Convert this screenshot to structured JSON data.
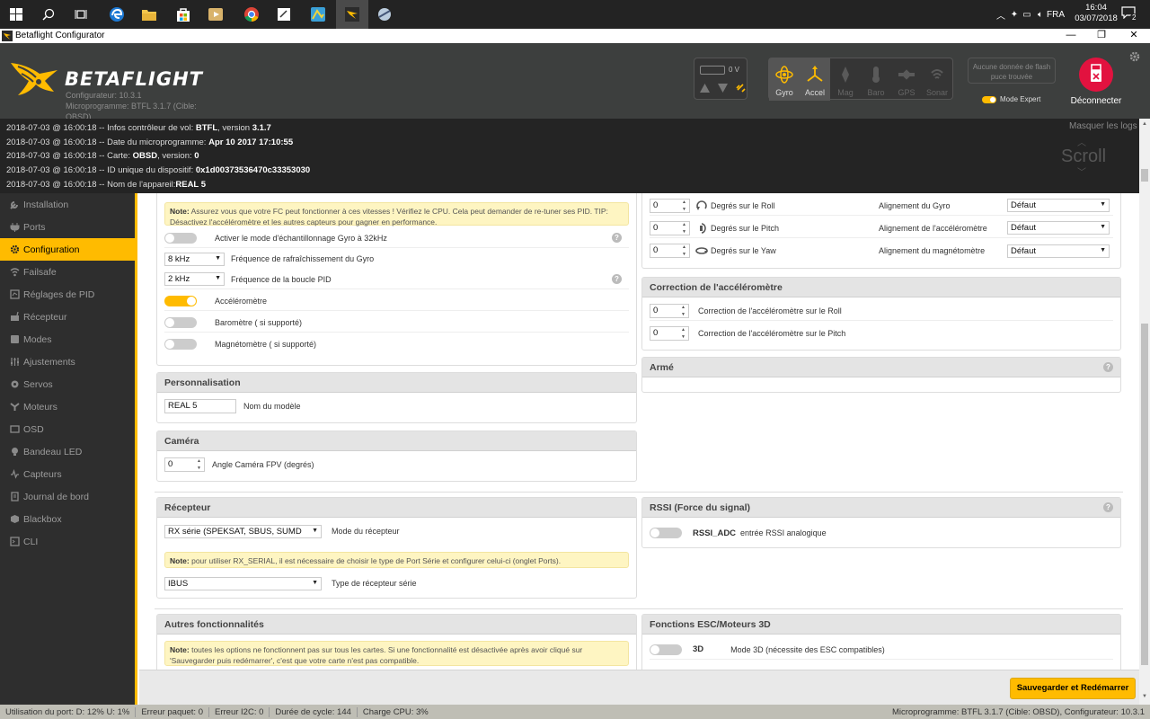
{
  "taskbar": {
    "language": "FRA",
    "time": "16:04",
    "date": "03/07/2018",
    "notification_count": "2"
  },
  "window": {
    "title": "Betaflight Configurator",
    "minimize": "—",
    "maximize": "❐",
    "close": "✕"
  },
  "header": {
    "logo_text": "BETAFLIGHT",
    "configurator_version": "Configurateur: 10.3.1",
    "firmware_line1": "Microprogramme: BTFL 3.1.7 (Cible:",
    "firmware_line2": "OBSD)",
    "battery_voltage": "0 V",
    "sensors": [
      {
        "label": "Gyro",
        "icon": "gyro-icon",
        "active": true
      },
      {
        "label": "Accel",
        "icon": "accel-icon",
        "active": true
      },
      {
        "label": "Mag",
        "icon": "mag-icon",
        "active": false
      },
      {
        "label": "Baro",
        "icon": "baro-icon",
        "active": false
      },
      {
        "label": "GPS",
        "icon": "gps-icon",
        "active": false
      },
      {
        "label": "Sonar",
        "icon": "sonar-icon",
        "active": false
      }
    ],
    "no_data": "Aucune donnée de flash puce trouvée",
    "expert_mode": "Mode Expert",
    "disconnect": "Déconnecter"
  },
  "log": {
    "hide": "Masquer les logs",
    "scroll": "Scroll",
    "lines": [
      {
        "prefix": "2018-07-03 @ 16:00:18 -- Infos contrôleur de vol: ",
        "b1": "BTFL",
        "mid": ", version ",
        "b2": "3.1.7"
      },
      {
        "prefix": "2018-07-03 @ 16:00:18 -- Date du microprogramme: ",
        "b1": "Apr 10 2017 17:10:55",
        "mid": "",
        "b2": ""
      },
      {
        "prefix": "2018-07-03 @ 16:00:18 -- Carte: ",
        "b1": "OBSD",
        "mid": ", version: ",
        "b2": "0"
      },
      {
        "prefix": "2018-07-03 @ 16:00:18 -- ID unique du dispositif: ",
        "b1": "0x1d00373536470c33353030",
        "mid": "",
        "b2": ""
      },
      {
        "prefix": "2018-07-03 @ 16:00:18 -- Nom de l'appareil:",
        "b1": "REAL 5",
        "mid": "",
        "b2": ""
      }
    ]
  },
  "sidebar": {
    "items": [
      {
        "label": "Installation",
        "icon": "wrench-icon"
      },
      {
        "label": "Ports",
        "icon": "plug-icon"
      },
      {
        "label": "Configuration",
        "icon": "gear-icon"
      },
      {
        "label": "Failsafe",
        "icon": "failsafe-icon"
      },
      {
        "label": "Réglages de PID",
        "icon": "pid-icon"
      },
      {
        "label": "Récepteur",
        "icon": "receiver-icon"
      },
      {
        "label": "Modes",
        "icon": "modes-icon"
      },
      {
        "label": "Ajustements",
        "icon": "sliders-icon"
      },
      {
        "label": "Servos",
        "icon": "servo-icon"
      },
      {
        "label": "Moteurs",
        "icon": "motor-icon"
      },
      {
        "label": "OSD",
        "icon": "osd-icon"
      },
      {
        "label": "Bandeau LED",
        "icon": "led-icon"
      },
      {
        "label": "Capteurs",
        "icon": "sensors-icon"
      },
      {
        "label": "Journal de bord",
        "icon": "log-icon"
      },
      {
        "label": "Blackbox",
        "icon": "blackbox-icon"
      },
      {
        "label": "CLI",
        "icon": "terminal-icon"
      }
    ],
    "active_index": 2
  },
  "system": {
    "note_label": "Note:",
    "note_text": " Assurez vous que votre FC peut fonctionner à ces vitesses ! Vérifiez le CPU. Cela peut demander de re-tuner ses PID. TIP: Désactivez l'accéléromètre et les autres capteurs pour gagner en performance.",
    "gyro32_label": "Activer le mode d'échantillonnage Gyro à 32kHz",
    "gyro_freq_value": "8 kHz",
    "gyro_freq_label": "Fréquence de rafraîchissement du Gyro",
    "pid_freq_value": "2 kHz",
    "pid_freq_label": "Fréquence de la boucle PID",
    "accel_label": "Accéléromètre",
    "baro_label": "Baromètre ( si supporté)",
    "mag_label": "Magnétomètre ( si supporté)"
  },
  "alignment": {
    "rows": [
      {
        "value": "0",
        "label": "Degrés sur le Roll",
        "icon": "roll-icon",
        "align_label": "Alignement du Gyro",
        "align_value": "Défaut"
      },
      {
        "value": "0",
        "label": "Degrés sur le Pitch",
        "icon": "pitch-icon",
        "align_label": "Alignement de l'accéléromètre",
        "align_value": "Défaut"
      },
      {
        "value": "0",
        "label": "Degrés sur le Yaw",
        "icon": "yaw-icon",
        "align_label": "Alignement du magnétomètre",
        "align_value": "Défaut"
      }
    ]
  },
  "accel_correction": {
    "title": "Correction de l'accéléromètre",
    "roll_value": "0",
    "roll_label": "Correction de l'accéléromètre sur le Roll",
    "pitch_value": "0",
    "pitch_label": "Correction de l'accéléromètre sur le Pitch"
  },
  "armed": {
    "title": "Armé"
  },
  "personalization": {
    "title": "Personnalisation",
    "name_value": "REAL 5",
    "name_label": "Nom du modèle"
  },
  "camera": {
    "title": "Caméra",
    "angle_value": "0",
    "angle_label": "Angle Caméra FPV (degrés)"
  },
  "receiver": {
    "title": "Récepteur",
    "mode_value": "RX série (SPEKSAT, SBUS, SUMD",
    "mode_label": "Mode du récepteur",
    "note_label": "Note:",
    "note_text": " pour utiliser RX_SERIAL, il est nécessaire de choisir le type de Port Série et configurer celui-ci (onglet Ports).",
    "serial_value": "IBUS",
    "serial_label": "Type de récepteur série"
  },
  "rssi": {
    "title": "RSSI (Force du signal)",
    "name": "RSSI_ADC",
    "label": "entrée RSSI analogique"
  },
  "other": {
    "title": "Autres fonctionnalités",
    "note_label": "Note:",
    "note_text": " toutes les options ne fonctionnent pas sur tous les cartes. Si une fonctionnalité est désactivée après avoir cliqué sur 'Sauvegarder puis redémarrer', c'est que votre carte n'est pas compatible."
  },
  "esc3d": {
    "title": "Fonctions ESC/Moteurs 3D",
    "name": "3D",
    "label": "Mode 3D (nécessite des ESC compatibles)"
  },
  "save_button": "Sauvegarder et Redémarrer",
  "status": {
    "port_usage": "Utilisation du port: D: 12% U: 1%",
    "packet_error": "Erreur paquet: 0",
    "i2c_error": "Erreur I2C: 0",
    "cycle_time": "Durée de cycle: 144",
    "cpu_load": "Charge CPU: 3%",
    "versions": "Microprogramme: BTFL 3.1.7 (Cible: OBSD), Configurateur: 10.3.1"
  },
  "colors": {
    "accent": "#ffbb00",
    "header_bg": "#3d3f3e",
    "log_bg": "#242424",
    "sidebar_bg": "#2e2e2e",
    "disconnect_red": "#e2123f"
  }
}
